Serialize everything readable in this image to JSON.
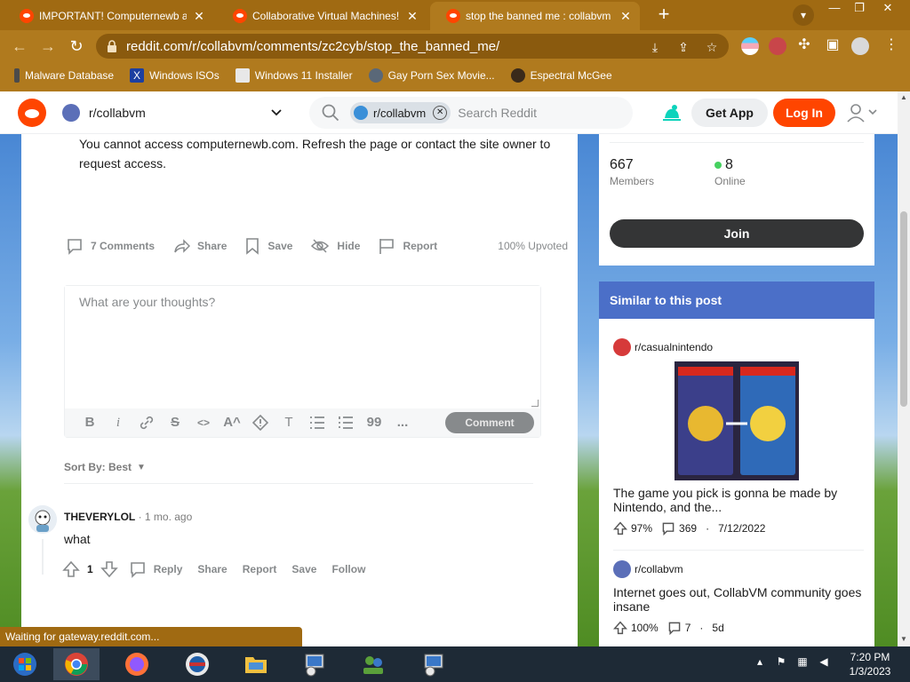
{
  "browser": {
    "tabs": [
      {
        "title": "IMPORTANT! Computernewb and",
        "active": false
      },
      {
        "title": "Collaborative Virtual Machines!",
        "active": false
      },
      {
        "title": "stop the banned me : collabvm",
        "active": true
      }
    ],
    "url": "reddit.com/r/collabvm/comments/zc2cyb/stop_the_banned_me/",
    "bookmarks": [
      {
        "label": "Malware Database",
        "icon": "malware-icon"
      },
      {
        "label": "Windows ISOs",
        "icon": "x-icon"
      },
      {
        "label": "Windows 11 Installer",
        "icon": "image-icon"
      },
      {
        "label": "Gay Porn Sex Movie...",
        "icon": "globe-icon"
      },
      {
        "label": "Espectral McGee",
        "icon": "ghost-icon"
      }
    ],
    "status": "Waiting for gateway.reddit.com..."
  },
  "header": {
    "community": "r/collabvm",
    "search_chip": "r/collabvm",
    "search_placeholder": "Search Reddit",
    "get_app": "Get App",
    "log_in": "Log In"
  },
  "post": {
    "body": "You cannot access computernewb.com. Refresh the page or contact the site owner to request access.",
    "actions": {
      "comments": "7 Comments",
      "share": "Share",
      "save": "Save",
      "hide": "Hide",
      "report": "Report"
    },
    "upvoted": "100% Upvoted"
  },
  "comment_box": {
    "placeholder": "What are your thoughts?",
    "submit": "Comment",
    "format_buttons": [
      "B",
      "i",
      "link",
      "S",
      "<>",
      "A^",
      "!",
      "T",
      "list",
      "ol",
      "99",
      "..."
    ]
  },
  "sort": {
    "label": "Sort By: Best"
  },
  "comments": [
    {
      "author": "THEVERYLOL",
      "time": "· 1 mo. ago",
      "text": "what",
      "score": "1",
      "actions": [
        "Reply",
        "Share",
        "Report",
        "Save",
        "Follow"
      ]
    }
  ],
  "sidebar": {
    "members": "667",
    "members_label": "Members",
    "online": "8",
    "online_label": "Online",
    "join": "Join",
    "similar_title": "Similar to this post",
    "similar": [
      {
        "sub": "r/casualnintendo",
        "title": "The game you pick is gonna be made by Nintendo, and the...",
        "upvote": "97%",
        "comments": "369",
        "date": "7/12/2022"
      },
      {
        "sub": "r/collabvm",
        "title": "Internet goes out, CollabVM community goes insane",
        "upvote": "100%",
        "comments": "7",
        "date": "5d"
      }
    ]
  },
  "taskbar": {
    "time": "7:20 PM",
    "date": "1/3/2023"
  },
  "colors": {
    "reddit_orange": "#ff4500",
    "chrome_theme": "#b07a1e",
    "similar_header": "#4b6fc8"
  }
}
